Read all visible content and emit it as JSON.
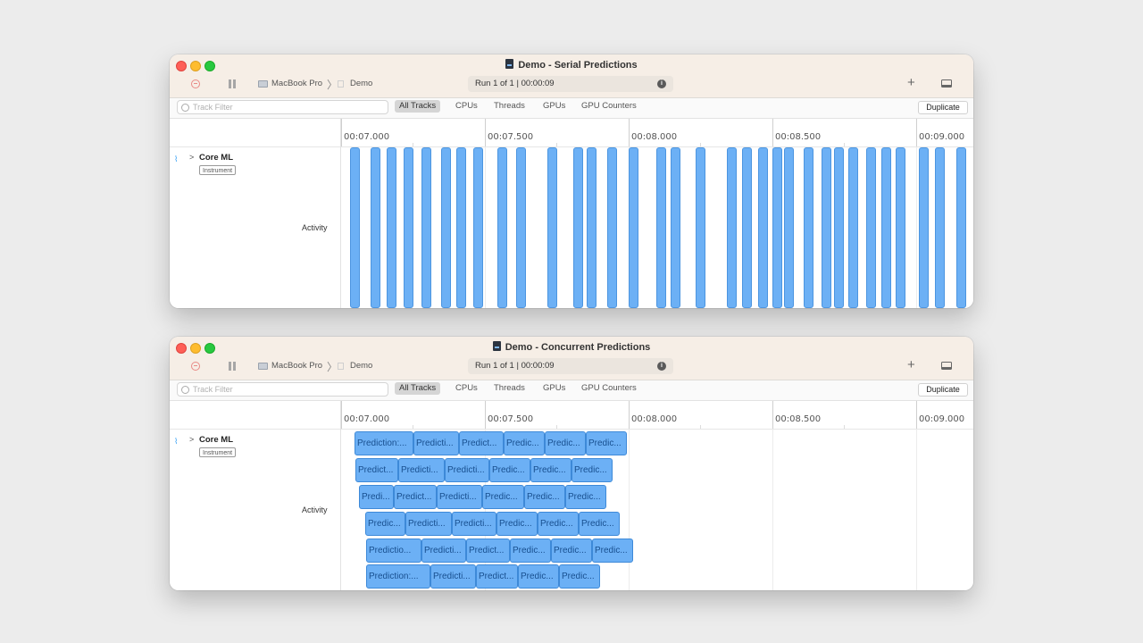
{
  "windows": [
    {
      "title": "Demo - Serial Predictions",
      "toolbar": {
        "device": "MacBook Pro",
        "target": "Demo",
        "run_info": "Run 1 of 1  |  00:00:09"
      },
      "filter": {
        "placeholder": "Track Filter",
        "tabs": [
          "All Tracks",
          "CPUs",
          "Threads",
          "GPUs",
          "GPU Counters"
        ],
        "selected": "All Tracks",
        "duplicate_label": "Duplicate"
      },
      "ruler": [
        "00:07.000",
        "00:07.500",
        "00:08.000",
        "00:08.500",
        "00:09.000"
      ],
      "track": {
        "name": "Core ML",
        "badge": "Instrument",
        "lane_label": "Activity"
      }
    },
    {
      "title": "Demo - Concurrent Predictions",
      "toolbar": {
        "device": "MacBook Pro",
        "target": "Demo",
        "run_info": "Run 1 of 1  |  00:00:09"
      },
      "filter": {
        "placeholder": "Track Filter",
        "tabs": [
          "All Tracks",
          "CPUs",
          "Threads",
          "GPUs",
          "GPU Counters"
        ],
        "selected": "All Tracks",
        "duplicate_label": "Duplicate"
      },
      "ruler": [
        "00:07.000",
        "00:07.500",
        "00:08.000",
        "00:08.500",
        "00:09.000"
      ],
      "track": {
        "name": "Core ML",
        "badge": "Instrument",
        "lane_label": "Activity"
      },
      "prediction_rows": [
        [
          "Prediction:...",
          "Predicti...",
          "Predict...",
          "Predic...",
          "Predic...",
          "Predic..."
        ],
        [
          "Predict...",
          "Predicti...",
          "Predicti...",
          "Predic...",
          "Predic...",
          "Predic..."
        ],
        [
          "Predi...",
          "Predict...",
          "Predicti...",
          "Predic...",
          "Predic...",
          "Predic..."
        ],
        [
          "Predic...",
          "Predicti...",
          "Predicti...",
          "Predic...",
          "Predic...",
          "Predic..."
        ],
        [
          "Predictio...",
          "Predicti...",
          "Predict...",
          "Predic...",
          "Predic...",
          "Predic..."
        ],
        [
          "Prediction:...",
          "Predicti...",
          "Predict...",
          "Predic...",
          "Predic..."
        ]
      ]
    }
  ],
  "colors": {
    "interval_fill": "#6cb0f5",
    "titlebar": "#f6eee6",
    "window_bg": "#ececec"
  }
}
